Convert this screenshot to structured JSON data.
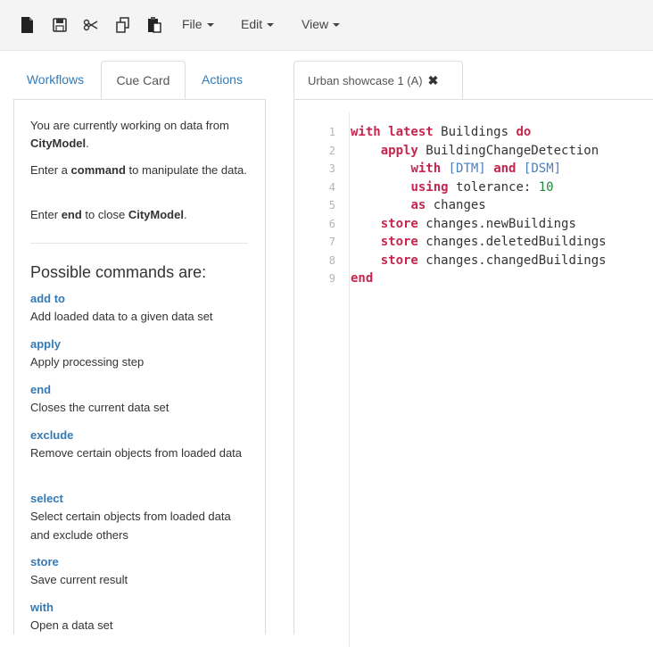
{
  "toolbar": {
    "icons": [
      "new-file-icon",
      "save-icon",
      "cut-icon",
      "copy-icon",
      "paste-icon"
    ],
    "menus": [
      {
        "label": "File"
      },
      {
        "label": "Edit"
      },
      {
        "label": "View"
      }
    ]
  },
  "left_tabs": [
    {
      "label": "Workflows"
    },
    {
      "label": "Cue Card"
    },
    {
      "label": "Actions"
    }
  ],
  "cue_card": {
    "p1_pre": "You are currently working on data from ",
    "p1_bold": "CityModel",
    "p1_post": ".",
    "p2_pre": "Enter a ",
    "p2_bold": "command",
    "p2_post": " to manipulate the data.",
    "p3_pre": "Enter ",
    "p3_bold1": "end",
    "p3_mid": " to close ",
    "p3_bold2": "CityModel",
    "p3_post": ".",
    "heading": "Possible commands are:",
    "commands": [
      {
        "name": "add to",
        "desc": "Add loaded data to a given data set"
      },
      {
        "name": "apply",
        "desc": "Apply processing step"
      },
      {
        "name": "end",
        "desc": "Closes the current data set"
      },
      {
        "name": "exclude",
        "desc": "Remove certain objects from loaded data"
      },
      {
        "name": "select",
        "desc": "Select certain objects from loaded data and exclude others"
      },
      {
        "name": "store",
        "desc": "Save current result"
      },
      {
        "name": "with",
        "desc": "Open a data set"
      }
    ]
  },
  "editor": {
    "tab_label": "Urban showcase 1 (A)",
    "close_glyph": "✖",
    "lines": [
      {
        "num": "1",
        "parts": [
          [
            "kw",
            "with latest"
          ],
          [
            "id",
            " Buildings "
          ],
          [
            "kw",
            "do"
          ]
        ]
      },
      {
        "num": "2",
        "parts": [
          [
            "id",
            "    "
          ],
          [
            "kw",
            "apply"
          ],
          [
            "id",
            " BuildingChangeDetection"
          ]
        ]
      },
      {
        "num": "3",
        "parts": [
          [
            "id",
            "        "
          ],
          [
            "kw",
            "with"
          ],
          [
            "id",
            " "
          ],
          [
            "br",
            "[DTM]"
          ],
          [
            "id",
            " "
          ],
          [
            "kw",
            "and"
          ],
          [
            "id",
            " "
          ],
          [
            "br",
            "[DSM]"
          ]
        ]
      },
      {
        "num": "4",
        "parts": [
          [
            "id",
            "        "
          ],
          [
            "kw",
            "using"
          ],
          [
            "id",
            " tolerance: "
          ],
          [
            "num",
            "10"
          ]
        ]
      },
      {
        "num": "5",
        "parts": [
          [
            "id",
            "        "
          ],
          [
            "kw",
            "as"
          ],
          [
            "id",
            " changes"
          ]
        ]
      },
      {
        "num": "6",
        "parts": [
          [
            "id",
            "    "
          ],
          [
            "kw",
            "store"
          ],
          [
            "id",
            " changes.newBuildings"
          ]
        ]
      },
      {
        "num": "7",
        "parts": [
          [
            "id",
            "    "
          ],
          [
            "kw",
            "store"
          ],
          [
            "id",
            " changes.deletedBuildings"
          ]
        ]
      },
      {
        "num": "8",
        "parts": [
          [
            "id",
            "    "
          ],
          [
            "kw",
            "store"
          ],
          [
            "id",
            " changes.changedBuildings"
          ]
        ]
      },
      {
        "num": "9",
        "parts": [
          [
            "kw",
            "end"
          ]
        ]
      }
    ]
  }
}
